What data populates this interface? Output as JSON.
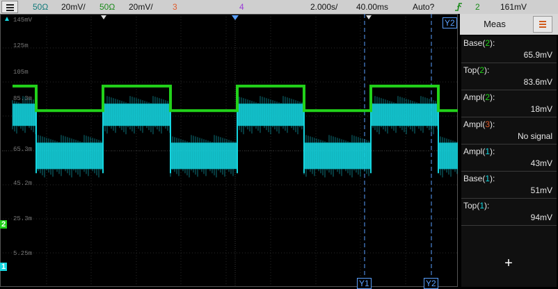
{
  "statusbar": {
    "ch1_impedance": "50Ω",
    "ch1_scale": "20mV/",
    "ch2_impedance": "50Ω",
    "ch2_scale": "20mV/",
    "ch3_label": "3",
    "ch4_label": "4",
    "timebase": "2.000s/",
    "delay": "40.00ms",
    "trigger_mode": "Auto?",
    "trigger_channel": "2",
    "trigger_level": "161mV"
  },
  "plot": {
    "y_labels": [
      "145mV",
      "125m",
      "105m",
      "85.3m",
      "65.3m",
      "45.2m",
      "25.3m",
      "5.25m"
    ],
    "cursor_labels": {
      "y1": "Y1",
      "y2": "Y2"
    },
    "ground_markers": {
      "ch2": "2",
      "ch1": "1"
    }
  },
  "chart_data": {
    "type": "line",
    "x_unit": "time",
    "y_unit": "V",
    "series": [
      {
        "name": "2",
        "color": "#22d21a",
        "high": 0.1045,
        "low": 0.0893
      },
      {
        "name": "1",
        "color": "#14d6e0",
        "high": 0.085,
        "low": 0.06,
        "noise": true
      }
    ]
  },
  "meas_panel": {
    "title": "Meas",
    "items": [
      {
        "name": "Base(2):",
        "value": "65.9mV"
      },
      {
        "name": "Top(2):",
        "value": "83.6mV"
      },
      {
        "name": "Ampl(2):",
        "value": "18mV"
      },
      {
        "name": "Ampl(3):",
        "value": "No signal"
      },
      {
        "name": "Ampl(1):",
        "value": "43mV"
      },
      {
        "name": "Base(1):",
        "value": "51mV"
      },
      {
        "name": "Top(1):",
        "value": "94mV"
      }
    ],
    "add_label": "+"
  },
  "colors": {
    "ch1": "#14d6e0",
    "ch2": "#22d21a",
    "ch3": "#e05a2a",
    "ch4": "#9a3ad8",
    "cursor": "#5aa0ff"
  }
}
